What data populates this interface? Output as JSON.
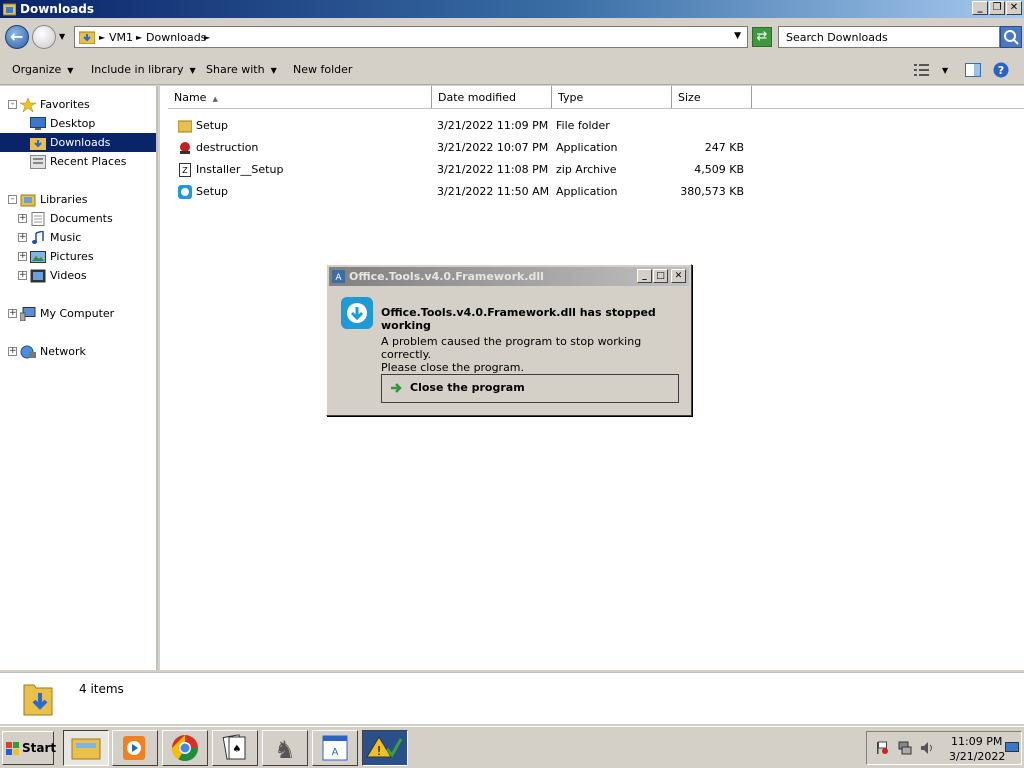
{
  "window": {
    "title": "Downloads"
  },
  "address": {
    "crumbs": [
      "VM1",
      "Downloads"
    ],
    "search_placeholder": "Search Downloads"
  },
  "commands": {
    "organize": "Organize",
    "include_library": "Include in library",
    "share_with": "Share with",
    "new_folder": "New folder"
  },
  "nav": {
    "favorites": "Favorites",
    "desktop": "Desktop",
    "downloads": "Downloads",
    "recent_places": "Recent Places",
    "libraries": "Libraries",
    "documents": "Documents",
    "music": "Music",
    "pictures": "Pictures",
    "videos": "Videos",
    "my_computer": "My Computer",
    "network": "Network"
  },
  "columns": {
    "name": "Name",
    "date": "Date modified",
    "type": "Type",
    "size": "Size"
  },
  "files": [
    {
      "name": "Setup",
      "date": "3/21/2022 11:09 PM",
      "type": "File folder",
      "size": "",
      "icon": "folder-icon"
    },
    {
      "name": "destruction",
      "date": "3/21/2022 10:07 PM",
      "type": "Application",
      "size": "247 KB",
      "icon": "app-red-icon"
    },
    {
      "name": "Installer__Setup",
      "date": "3/21/2022 11:08 PM",
      "type": "zip Archive",
      "size": "4,509 KB",
      "icon": "zip-icon"
    },
    {
      "name": "Setup",
      "date": "3/21/2022 11:50 AM",
      "type": "Application",
      "size": "380,573 KB",
      "icon": "setup-app-icon"
    }
  ],
  "status": {
    "count": "4 items"
  },
  "dialog": {
    "title": "Office.Tools.v4.0.Framework.dll",
    "heading": "Office.Tools.v4.0.Framework.dll has stopped working",
    "line1": "A problem caused the program to stop working correctly.",
    "line2": "Please close the program.",
    "close_label": "Close the program"
  },
  "taskbar": {
    "start": "Start",
    "time": "11:09 PM",
    "date": "3/21/2022"
  }
}
